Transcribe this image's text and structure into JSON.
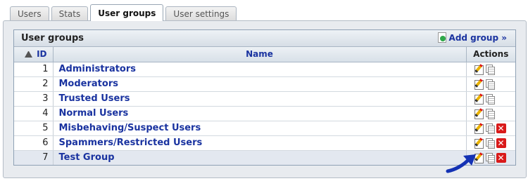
{
  "tabs": [
    {
      "label": "Users",
      "active": false
    },
    {
      "label": "Stats",
      "active": false
    },
    {
      "label": "User groups",
      "active": true
    },
    {
      "label": "User settings",
      "active": false
    }
  ],
  "panel": {
    "title": "User groups",
    "add_group_label": "Add group »"
  },
  "table": {
    "headers": {
      "id": "ID",
      "name": "Name",
      "actions": "Actions"
    },
    "rows": [
      {
        "id": "1",
        "name": "Administrators",
        "deletable": false
      },
      {
        "id": "2",
        "name": "Moderators",
        "deletable": false
      },
      {
        "id": "3",
        "name": "Trusted Users",
        "deletable": false
      },
      {
        "id": "4",
        "name": "Normal Users",
        "deletable": false
      },
      {
        "id": "5",
        "name": "Misbehaving/Suspect Users",
        "deletable": true
      },
      {
        "id": "6",
        "name": "Spammers/Restricted Users",
        "deletable": true
      },
      {
        "id": "7",
        "name": "Test Group",
        "deletable": true
      }
    ]
  },
  "icons": {
    "sort": "sort-ascending-icon",
    "edit": "pencil-icon",
    "copy": "copy-icon",
    "delete": "delete-icon",
    "add": "add-document-icon"
  },
  "colors": {
    "link": "#1a33a0",
    "delete": "#d91a1a",
    "arrow": "#1432b4"
  }
}
